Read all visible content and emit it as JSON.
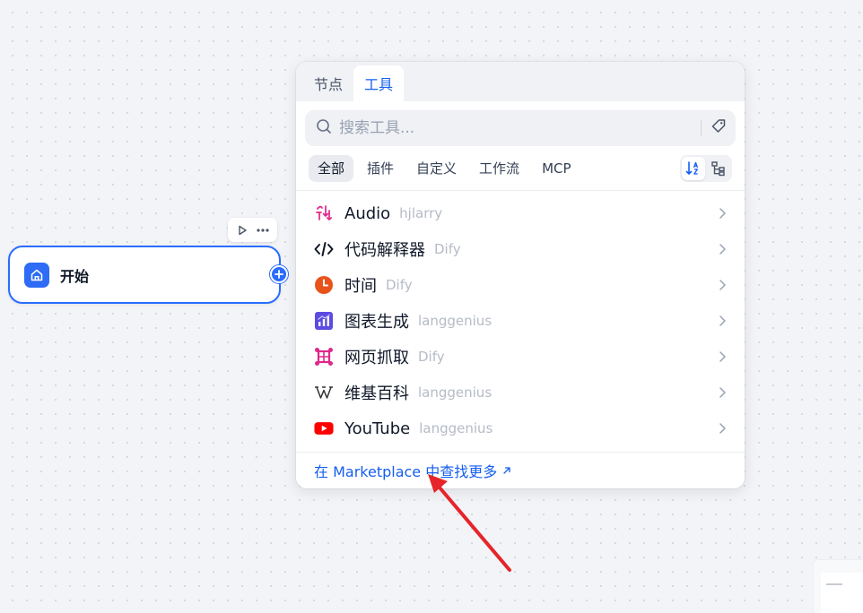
{
  "start_node": {
    "title": "开始",
    "icon": "home-icon",
    "accent_color": "#296dff"
  },
  "node_toolbar": {
    "run_icon": "play-icon",
    "more_icon": "more-icon"
  },
  "panel": {
    "tabs": [
      {
        "label": "节点",
        "active": false
      },
      {
        "label": "工具",
        "active": true
      }
    ],
    "search": {
      "placeholder": "搜索工具..."
    },
    "filters": [
      {
        "label": "全部",
        "active": true
      },
      {
        "label": "插件",
        "active": false
      },
      {
        "label": "自定义",
        "active": false
      },
      {
        "label": "工作流",
        "active": false
      },
      {
        "label": "MCP",
        "active": false
      }
    ],
    "tools": [
      {
        "name": "Audio",
        "author": "hjlarry",
        "icon": "audio-icon"
      },
      {
        "name": "代码解释器",
        "author": "Dify",
        "icon": "code-icon"
      },
      {
        "name": "时间",
        "author": "Dify",
        "icon": "clock-icon"
      },
      {
        "name": "图表生成",
        "author": "langgenius",
        "icon": "chart-icon"
      },
      {
        "name": "网页抓取",
        "author": "Dify",
        "icon": "web-scraper-icon"
      },
      {
        "name": "维基百科",
        "author": "langgenius",
        "icon": "wikipedia-icon"
      },
      {
        "name": "YouTube",
        "author": "langgenius",
        "icon": "youtube-icon"
      }
    ],
    "footer_link": "在 Marketplace 中查找更多"
  },
  "colors": {
    "brand": "#155eef",
    "annotation_arrow": "#e5252a"
  }
}
